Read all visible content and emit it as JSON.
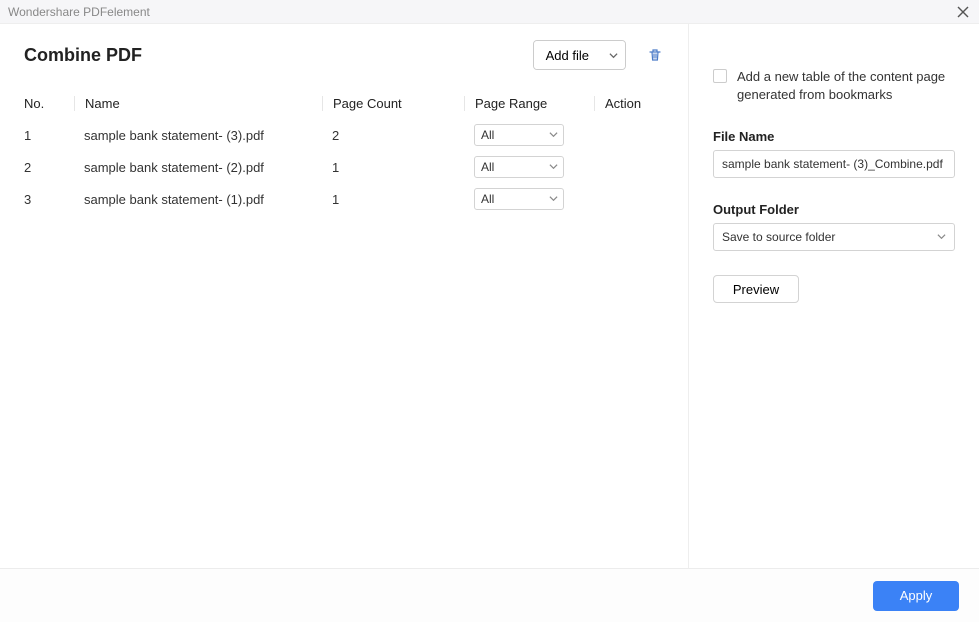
{
  "window": {
    "title": "Wondershare PDFelement"
  },
  "main": {
    "title": "Combine PDF",
    "add_file_label": "Add file",
    "columns": {
      "no": "No.",
      "name": "Name",
      "count": "Page Count",
      "range": "Page Range",
      "action": "Action"
    },
    "rows": [
      {
        "no": "1",
        "name": "sample bank statement- (3).pdf",
        "count": "2",
        "range": "All"
      },
      {
        "no": "2",
        "name": "sample bank statement- (2).pdf",
        "count": "1",
        "range": "All"
      },
      {
        "no": "3",
        "name": "sample bank statement- (1).pdf",
        "count": "1",
        "range": "All"
      }
    ]
  },
  "side": {
    "toc_label": "Add a new table of the content page generated from bookmarks",
    "file_name_label": "File Name",
    "file_name_value": "sample bank statement- (3)_Combine.pdf",
    "output_folder_label": "Output Folder",
    "output_folder_value": "Save to source folder",
    "preview_label": "Preview"
  },
  "footer": {
    "apply_label": "Apply"
  }
}
